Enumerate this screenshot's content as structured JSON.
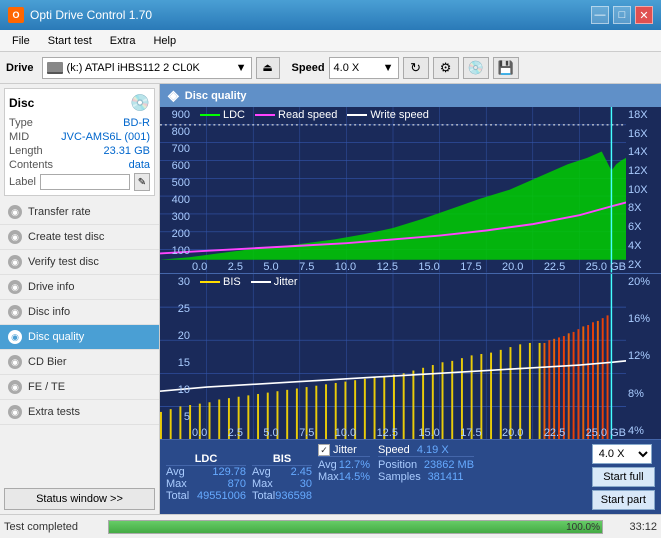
{
  "app": {
    "title": "Opti Drive Control 1.70",
    "icon": "O"
  },
  "titlebar": {
    "minimize": "—",
    "maximize": "□",
    "close": "✕"
  },
  "menu": {
    "items": [
      "File",
      "Start test",
      "Extra",
      "Help"
    ]
  },
  "toolbar": {
    "drive_label": "Drive",
    "drive_value": "(k:) ATAPl iHBS112  2 CL0K",
    "speed_label": "Speed",
    "speed_value": "4.0 X"
  },
  "disc_panel": {
    "type_label": "Type",
    "type_value": "BD-R",
    "mid_label": "MID",
    "mid_value": "JVC-AMS6L (001)",
    "length_label": "Length",
    "length_value": "23.31 GB",
    "contents_label": "Contents",
    "contents_value": "data",
    "label_label": "Label"
  },
  "nav": {
    "items": [
      {
        "id": "transfer-rate",
        "label": "Transfer rate",
        "active": false
      },
      {
        "id": "create-test-disc",
        "label": "Create test disc",
        "active": false
      },
      {
        "id": "verify-test-disc",
        "label": "Verify test disc",
        "active": false
      },
      {
        "id": "drive-info",
        "label": "Drive info",
        "active": false
      },
      {
        "id": "disc-info",
        "label": "Disc info",
        "active": false
      },
      {
        "id": "disc-quality",
        "label": "Disc quality",
        "active": true
      },
      {
        "id": "cd-bier",
        "label": "CD Bier",
        "active": false
      },
      {
        "id": "fe-te",
        "label": "FE / TE",
        "active": false
      },
      {
        "id": "extra-tests",
        "label": "Extra tests",
        "active": false
      }
    ],
    "status_btn": "Status window >>"
  },
  "panel": {
    "title": "Disc quality",
    "icon": "◈"
  },
  "chart1": {
    "legend": [
      {
        "label": "LDC",
        "color": "#00ff00"
      },
      {
        "label": "Read speed",
        "color": "#ff44ff"
      },
      {
        "label": "Write speed",
        "color": "white"
      }
    ],
    "y_axis_right": [
      "18X",
      "16X",
      "14X",
      "12X",
      "10X",
      "8X",
      "6X",
      "4X",
      "2X"
    ],
    "y_axis_left": [
      "900",
      "800",
      "700",
      "600",
      "500",
      "400",
      "300",
      "200",
      "100"
    ],
    "x_axis": [
      "0.0",
      "2.5",
      "5.0",
      "7.5",
      "10.0",
      "12.5",
      "15.0",
      "17.5",
      "20.0",
      "22.5",
      "25.0 GB"
    ]
  },
  "chart2": {
    "legend": [
      {
        "label": "BIS",
        "color": "#ffff00"
      },
      {
        "label": "Jitter",
        "color": "white"
      }
    ],
    "y_axis_right": [
      "20%",
      "16%",
      "12%",
      "8%",
      "4%"
    ],
    "y_axis_left": [
      "30",
      "25",
      "20",
      "15",
      "10",
      "5"
    ],
    "x_axis": [
      "0.0",
      "2.5",
      "5.0",
      "7.5",
      "10.0",
      "12.5",
      "15.0",
      "17.5",
      "20.0",
      "22.5",
      "25.0 GB"
    ]
  },
  "stats": {
    "ldc_label": "LDC",
    "bis_label": "BIS",
    "jitter_label": "Jitter",
    "speed_label": "Speed",
    "avg_label": "Avg",
    "max_label": "Max",
    "total_label": "Total",
    "ldc_avg": "129.78",
    "ldc_max": "870",
    "ldc_total": "49551006",
    "bis_avg": "2.45",
    "bis_max": "30",
    "bis_total": "936598",
    "jitter_avg": "12.7%",
    "jitter_max": "14.5%",
    "speed_val": "4.19 X",
    "speed_select": "4.0 X",
    "position_label": "Position",
    "position_val": "23862 MB",
    "samples_label": "Samples",
    "samples_val": "381411"
  },
  "buttons": {
    "start_full": "Start full",
    "start_part": "Start part"
  },
  "statusbar": {
    "text": "Test completed",
    "progress": "100.0%",
    "progress_pct": 100,
    "time": "33:12"
  }
}
